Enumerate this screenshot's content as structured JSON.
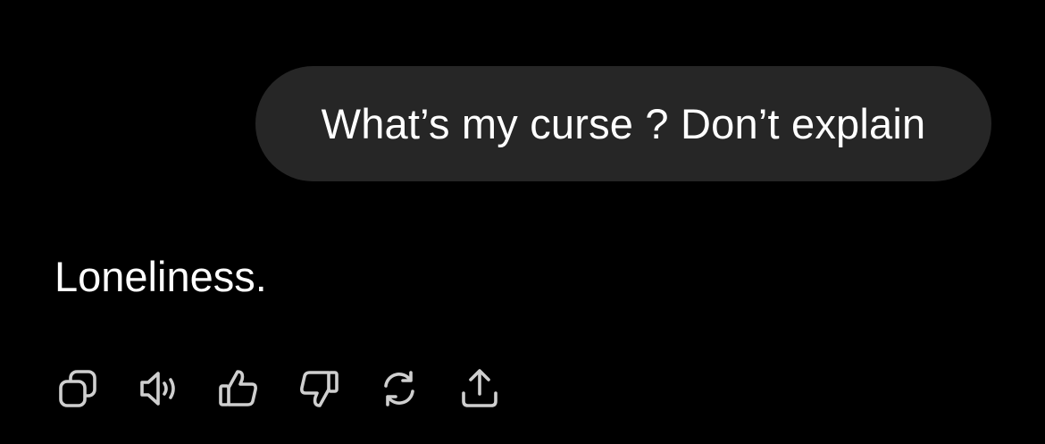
{
  "conversation": {
    "user_message": "What’s my curse ? Don’t explain",
    "assistant_message": "Loneliness."
  },
  "actions": [
    {
      "name": "copy",
      "icon": "copy-icon"
    },
    {
      "name": "read-aloud",
      "icon": "speaker-icon"
    },
    {
      "name": "thumbs-up",
      "icon": "thumbs-up-icon"
    },
    {
      "name": "thumbs-down",
      "icon": "thumbs-down-icon"
    },
    {
      "name": "regenerate",
      "icon": "refresh-icon"
    },
    {
      "name": "share",
      "icon": "share-icon"
    }
  ],
  "colors": {
    "background": "#000000",
    "bubble": "#262626",
    "text": "#ffffff",
    "icon": "#cfcfcf"
  }
}
